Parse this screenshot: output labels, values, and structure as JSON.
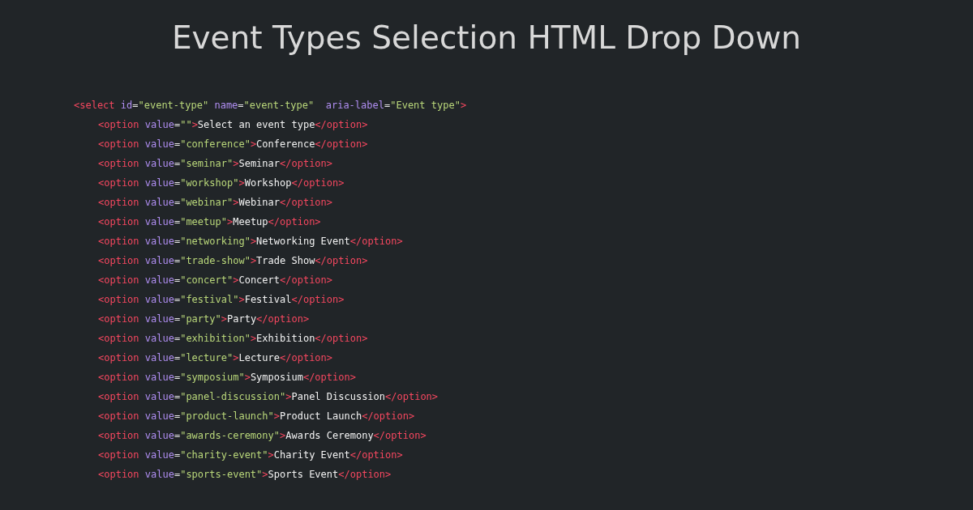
{
  "title": "Event Types Selection HTML Drop Down",
  "code": [
    {
      "tokens": [
        {
          "kind": "tag",
          "text": "<select"
        },
        {
          "kind": "attr",
          "text": " id"
        },
        {
          "kind": "eq",
          "text": "="
        },
        {
          "kind": "str",
          "text": "\"event-type\""
        },
        {
          "kind": "attr",
          "text": " name"
        },
        {
          "kind": "eq",
          "text": "="
        },
        {
          "kind": "str",
          "text": "\"event-type\""
        },
        {
          "kind": "attr",
          "text": "  aria-label"
        },
        {
          "kind": "eq",
          "text": "="
        },
        {
          "kind": "str",
          "text": "\"Event type\""
        },
        {
          "kind": "tag",
          "text": ">"
        }
      ],
      "children": [
        {
          "tokens": [
            {
              "kind": "tag",
              "text": "<option"
            },
            {
              "kind": "attr",
              "text": " value"
            },
            {
              "kind": "eq",
              "text": "="
            },
            {
              "kind": "str",
              "text": "\"\""
            },
            {
              "kind": "tag",
              "text": ">"
            },
            {
              "kind": "text",
              "text": "Select an event type"
            },
            {
              "kind": "tag",
              "text": "</option>"
            }
          ]
        },
        {
          "tokens": [
            {
              "kind": "tag",
              "text": "<option"
            },
            {
              "kind": "attr",
              "text": " value"
            },
            {
              "kind": "eq",
              "text": "="
            },
            {
              "kind": "str",
              "text": "\"conference\""
            },
            {
              "kind": "tag",
              "text": ">"
            },
            {
              "kind": "text",
              "text": "Conference"
            },
            {
              "kind": "tag",
              "text": "</option>"
            }
          ]
        },
        {
          "tokens": [
            {
              "kind": "tag",
              "text": "<option"
            },
            {
              "kind": "attr",
              "text": " value"
            },
            {
              "kind": "eq",
              "text": "="
            },
            {
              "kind": "str",
              "text": "\"seminar\""
            },
            {
              "kind": "tag",
              "text": ">"
            },
            {
              "kind": "text",
              "text": "Seminar"
            },
            {
              "kind": "tag",
              "text": "</option>"
            }
          ]
        },
        {
          "tokens": [
            {
              "kind": "tag",
              "text": "<option"
            },
            {
              "kind": "attr",
              "text": " value"
            },
            {
              "kind": "eq",
              "text": "="
            },
            {
              "kind": "str",
              "text": "\"workshop\""
            },
            {
              "kind": "tag",
              "text": ">"
            },
            {
              "kind": "text",
              "text": "Workshop"
            },
            {
              "kind": "tag",
              "text": "</option>"
            }
          ]
        },
        {
          "tokens": [
            {
              "kind": "tag",
              "text": "<option"
            },
            {
              "kind": "attr",
              "text": " value"
            },
            {
              "kind": "eq",
              "text": "="
            },
            {
              "kind": "str",
              "text": "\"webinar\""
            },
            {
              "kind": "tag",
              "text": ">"
            },
            {
              "kind": "text",
              "text": "Webinar"
            },
            {
              "kind": "tag",
              "text": "</option>"
            }
          ]
        },
        {
          "tokens": [
            {
              "kind": "tag",
              "text": "<option"
            },
            {
              "kind": "attr",
              "text": " value"
            },
            {
              "kind": "eq",
              "text": "="
            },
            {
              "kind": "str",
              "text": "\"meetup\""
            },
            {
              "kind": "tag",
              "text": ">"
            },
            {
              "kind": "text",
              "text": "Meetup"
            },
            {
              "kind": "tag",
              "text": "</option>"
            }
          ]
        },
        {
          "tokens": [
            {
              "kind": "tag",
              "text": "<option"
            },
            {
              "kind": "attr",
              "text": " value"
            },
            {
              "kind": "eq",
              "text": "="
            },
            {
              "kind": "str",
              "text": "\"networking\""
            },
            {
              "kind": "tag",
              "text": ">"
            },
            {
              "kind": "text",
              "text": "Networking Event"
            },
            {
              "kind": "tag",
              "text": "</option>"
            }
          ]
        },
        {
          "tokens": [
            {
              "kind": "tag",
              "text": "<option"
            },
            {
              "kind": "attr",
              "text": " value"
            },
            {
              "kind": "eq",
              "text": "="
            },
            {
              "kind": "str",
              "text": "\"trade-show\""
            },
            {
              "kind": "tag",
              "text": ">"
            },
            {
              "kind": "text",
              "text": "Trade Show"
            },
            {
              "kind": "tag",
              "text": "</option>"
            }
          ]
        },
        {
          "tokens": [
            {
              "kind": "tag",
              "text": "<option"
            },
            {
              "kind": "attr",
              "text": " value"
            },
            {
              "kind": "eq",
              "text": "="
            },
            {
              "kind": "str",
              "text": "\"concert\""
            },
            {
              "kind": "tag",
              "text": ">"
            },
            {
              "kind": "text",
              "text": "Concert"
            },
            {
              "kind": "tag",
              "text": "</option>"
            }
          ]
        },
        {
          "tokens": [
            {
              "kind": "tag",
              "text": "<option"
            },
            {
              "kind": "attr",
              "text": " value"
            },
            {
              "kind": "eq",
              "text": "="
            },
            {
              "kind": "str",
              "text": "\"festival\""
            },
            {
              "kind": "tag",
              "text": ">"
            },
            {
              "kind": "text",
              "text": "Festival"
            },
            {
              "kind": "tag",
              "text": "</option>"
            }
          ]
        },
        {
          "tokens": [
            {
              "kind": "tag",
              "text": "<option"
            },
            {
              "kind": "attr",
              "text": " value"
            },
            {
              "kind": "eq",
              "text": "="
            },
            {
              "kind": "str",
              "text": "\"party\""
            },
            {
              "kind": "tag",
              "text": ">"
            },
            {
              "kind": "text",
              "text": "Party"
            },
            {
              "kind": "tag",
              "text": "</option>"
            }
          ]
        },
        {
          "tokens": [
            {
              "kind": "tag",
              "text": "<option"
            },
            {
              "kind": "attr",
              "text": " value"
            },
            {
              "kind": "eq",
              "text": "="
            },
            {
              "kind": "str",
              "text": "\"exhibition\""
            },
            {
              "kind": "tag",
              "text": ">"
            },
            {
              "kind": "text",
              "text": "Exhibition"
            },
            {
              "kind": "tag",
              "text": "</option>"
            }
          ]
        },
        {
          "tokens": [
            {
              "kind": "tag",
              "text": "<option"
            },
            {
              "kind": "attr",
              "text": " value"
            },
            {
              "kind": "eq",
              "text": "="
            },
            {
              "kind": "str",
              "text": "\"lecture\""
            },
            {
              "kind": "tag",
              "text": ">"
            },
            {
              "kind": "text",
              "text": "Lecture"
            },
            {
              "kind": "tag",
              "text": "</option>"
            }
          ]
        },
        {
          "tokens": [
            {
              "kind": "tag",
              "text": "<option"
            },
            {
              "kind": "attr",
              "text": " value"
            },
            {
              "kind": "eq",
              "text": "="
            },
            {
              "kind": "str",
              "text": "\"symposium\""
            },
            {
              "kind": "tag",
              "text": ">"
            },
            {
              "kind": "text",
              "text": "Symposium"
            },
            {
              "kind": "tag",
              "text": "</option>"
            }
          ]
        },
        {
          "tokens": [
            {
              "kind": "tag",
              "text": "<option"
            },
            {
              "kind": "attr",
              "text": " value"
            },
            {
              "kind": "eq",
              "text": "="
            },
            {
              "kind": "str",
              "text": "\"panel-discussion\""
            },
            {
              "kind": "tag",
              "text": ">"
            },
            {
              "kind": "text",
              "text": "Panel Discussion"
            },
            {
              "kind": "tag",
              "text": "</option>"
            }
          ]
        },
        {
          "tokens": [
            {
              "kind": "tag",
              "text": "<option"
            },
            {
              "kind": "attr",
              "text": " value"
            },
            {
              "kind": "eq",
              "text": "="
            },
            {
              "kind": "str",
              "text": "\"product-launch\""
            },
            {
              "kind": "tag",
              "text": ">"
            },
            {
              "kind": "text",
              "text": "Product Launch"
            },
            {
              "kind": "tag",
              "text": "</option>"
            }
          ]
        },
        {
          "tokens": [
            {
              "kind": "tag",
              "text": "<option"
            },
            {
              "kind": "attr",
              "text": " value"
            },
            {
              "kind": "eq",
              "text": "="
            },
            {
              "kind": "str",
              "text": "\"awards-ceremony\""
            },
            {
              "kind": "tag",
              "text": ">"
            },
            {
              "kind": "text",
              "text": "Awards Ceremony"
            },
            {
              "kind": "tag",
              "text": "</option>"
            }
          ]
        },
        {
          "tokens": [
            {
              "kind": "tag",
              "text": "<option"
            },
            {
              "kind": "attr",
              "text": " value"
            },
            {
              "kind": "eq",
              "text": "="
            },
            {
              "kind": "str",
              "text": "\"charity-event\""
            },
            {
              "kind": "tag",
              "text": ">"
            },
            {
              "kind": "text",
              "text": "Charity Event"
            },
            {
              "kind": "tag",
              "text": "</option>"
            }
          ]
        },
        {
          "tokens": [
            {
              "kind": "tag",
              "text": "<option"
            },
            {
              "kind": "attr",
              "text": " value"
            },
            {
              "kind": "eq",
              "text": "="
            },
            {
              "kind": "str",
              "text": "\"sports-event\""
            },
            {
              "kind": "tag",
              "text": ">"
            },
            {
              "kind": "text",
              "text": "Sports Event"
            },
            {
              "kind": "tag",
              "text": "</option>"
            }
          ]
        }
      ]
    }
  ]
}
